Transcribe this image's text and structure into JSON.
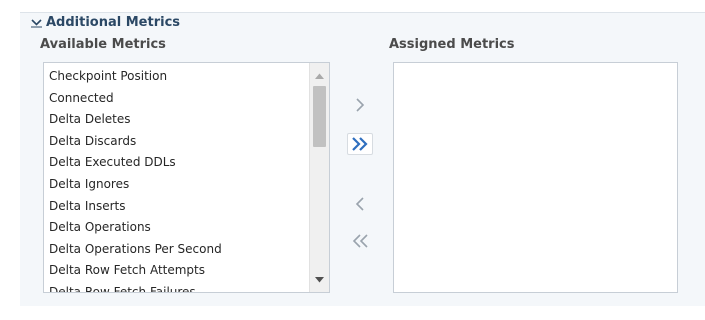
{
  "section": {
    "title": "Additional Metrics",
    "expanded": true
  },
  "available": {
    "label": "Available Metrics",
    "items": [
      "Checkpoint Position",
      "Connected",
      "Delta Deletes",
      "Delta Discards",
      "Delta Executed DDLs",
      "Delta Ignores",
      "Delta Inserts",
      "Delta Operations",
      "Delta Operations Per Second",
      "Delta Row Fetch Attempts",
      "Delta Row Fetch Failures"
    ]
  },
  "assigned": {
    "label": "Assigned Metrics",
    "items": []
  },
  "shuttle": {
    "move_icon": "chevron-right-icon",
    "move_all_icon": "double-chevron-right-icon",
    "remove_icon": "chevron-left-icon",
    "remove_all_icon": "double-chevron-left-icon"
  },
  "colors": {
    "section_title": "#2b4865",
    "panel_background": "#f4f7fa",
    "active_shuttle_icon": "#2f6fbf",
    "inactive_shuttle_icon": "#9aa3ad"
  }
}
